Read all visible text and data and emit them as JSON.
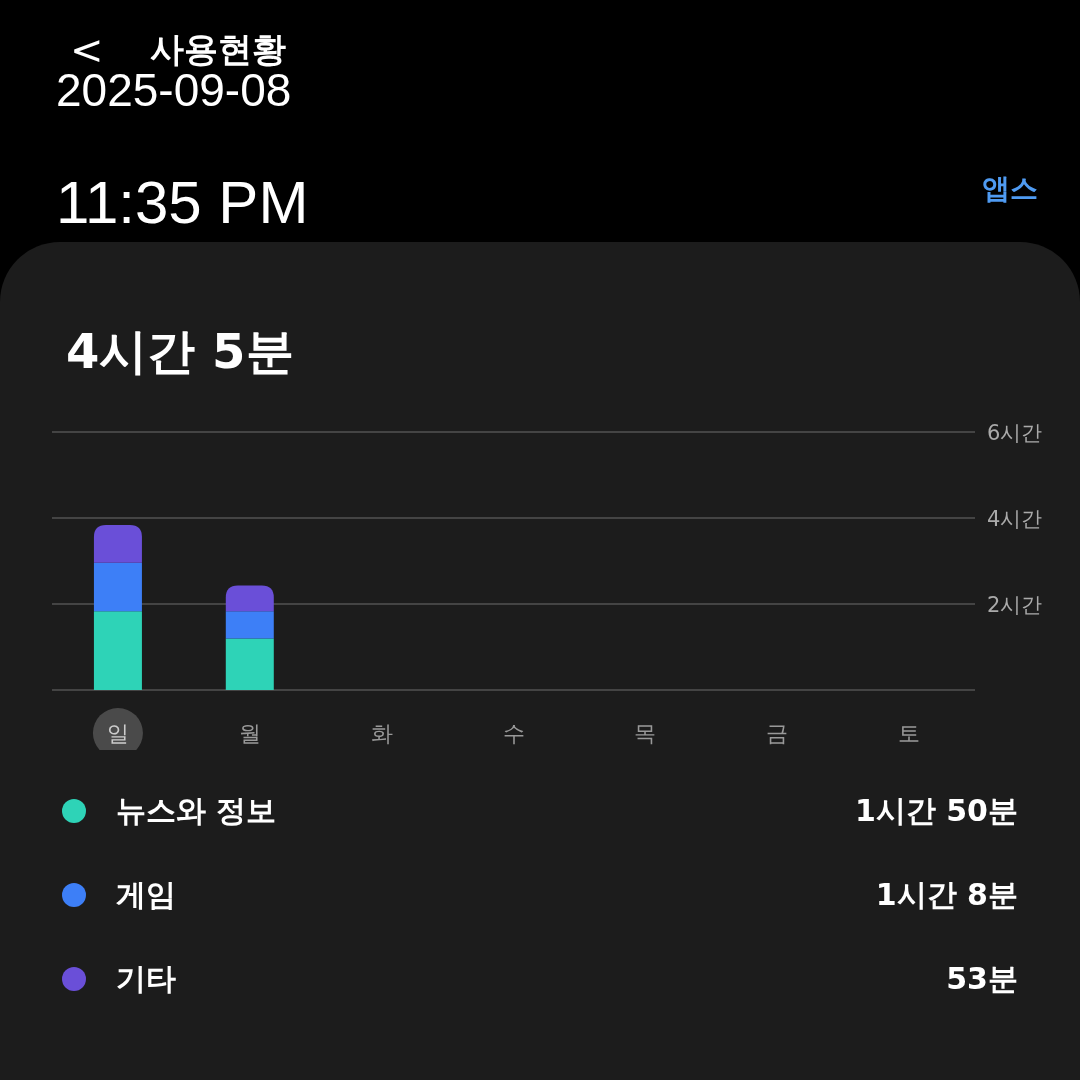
{
  "overlay": {
    "date": "2025-09-08",
    "time": "11:35 PM"
  },
  "header": {
    "back": "<",
    "title": "사용현황"
  },
  "apps_link": "앱스",
  "usage": {
    "total": "4시간 5분",
    "day_selected": [
      true,
      false,
      false,
      false,
      false,
      false,
      false
    ],
    "chart_data": {
      "type": "bar",
      "stacked": true,
      "categories": [
        "일",
        "월",
        "화",
        "수",
        "목",
        "금",
        "토"
      ],
      "ylim": [
        0,
        6
      ],
      "yticks": [
        {
          "value": 2,
          "label": "2시간"
        },
        {
          "value": 4,
          "label": "4시간"
        },
        {
          "value": 6,
          "label": "6시간"
        }
      ],
      "series": [
        {
          "name": "뉴스와 정보",
          "color": "#2ed3b7",
          "values": [
            1.83,
            1.2,
            null,
            null,
            null,
            null,
            null
          ]
        },
        {
          "name": "게임",
          "color": "#3d7ff7",
          "values": [
            1.13,
            0.63,
            null,
            null,
            null,
            null,
            null
          ]
        },
        {
          "name": "기타",
          "color": "#6a4fd8",
          "values": [
            0.88,
            0.6,
            null,
            null,
            null,
            null,
            null
          ]
        }
      ]
    }
  },
  "legend_values": [
    "1시간 50분",
    "1시간 8분",
    "53분"
  ]
}
